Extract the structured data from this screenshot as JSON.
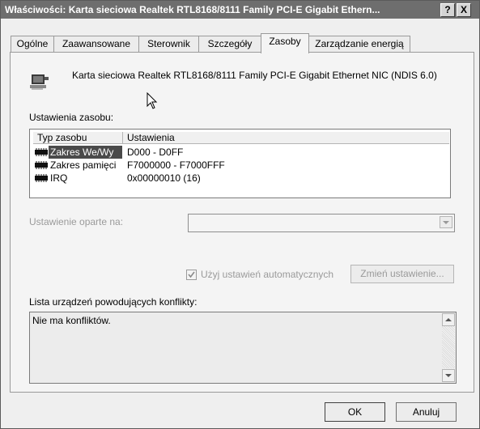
{
  "window": {
    "title": "Właściwości: Karta sieciowa Realtek RTL8168/8111 Family PCI-E Gigabit Ethern...",
    "help_button": "?",
    "close_button": "X"
  },
  "tabs": [
    {
      "label": "Ogólne",
      "active": false
    },
    {
      "label": "Zaawansowane",
      "active": false
    },
    {
      "label": "Sterownik",
      "active": false
    },
    {
      "label": "Szczegóły",
      "active": false
    },
    {
      "label": "Zasoby",
      "active": true
    },
    {
      "label": "Zarządzanie energią",
      "active": false
    }
  ],
  "device": {
    "name": "Karta sieciowa Realtek RTL8168/8111 Family PCI-E Gigabit Ethernet NIC (NDIS 6.0)",
    "icon": "network-card-icon"
  },
  "resources": {
    "section_label": "Ustawienia zasobu:",
    "columns": [
      "Typ zasobu",
      "Ustawienia"
    ],
    "rows": [
      {
        "type": "Zakres We/Wy",
        "setting": "D000 - D0FF",
        "icon": "chip-icon"
      },
      {
        "type": "Zakres pamięci",
        "setting": "F7000000 - F7000FFF",
        "icon": "chip-icon"
      },
      {
        "type": "IRQ",
        "setting": "0x00000010 (16)",
        "icon": "chip-icon"
      }
    ]
  },
  "based_on": {
    "label": "Ustawienie oparte na:",
    "value": ""
  },
  "auto_settings": {
    "label": "Użyj ustawień automatycznych",
    "checked": true
  },
  "change_button": "Zmień ustawienie...",
  "conflicts": {
    "label": "Lista urządzeń powodujących konflikty:",
    "text": "Nie ma konfliktów."
  },
  "footer": {
    "ok": "OK",
    "cancel": "Anuluj"
  },
  "colors": {
    "titlebar": "#6e6e6e",
    "window_bg": "#efefef",
    "panel_bg": "#f4f4f4",
    "disabled_text": "#9a9a9a"
  }
}
